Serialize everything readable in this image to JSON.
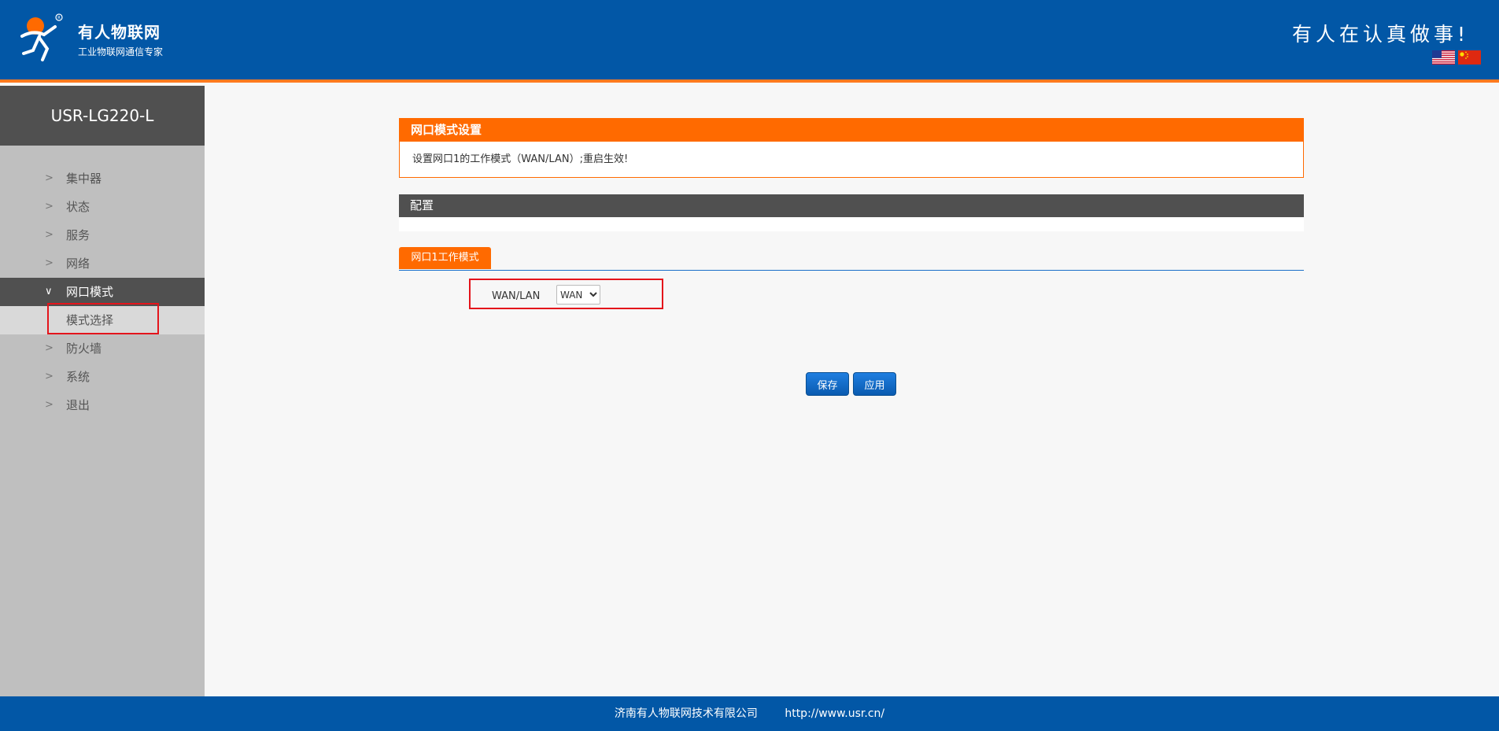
{
  "header": {
    "brand": "有人物联网",
    "brand_sub": "工业物联网通信专家",
    "slogan": "有人在认真做事!",
    "languages": [
      "English",
      "中文"
    ]
  },
  "sidebar": {
    "device": "USR-LG220-L",
    "items": [
      {
        "label": "集中器"
      },
      {
        "label": "状态"
      },
      {
        "label": "服务"
      },
      {
        "label": "网络"
      },
      {
        "label": "网口模式",
        "expanded": true,
        "children": [
          {
            "label": "模式选择",
            "selected": true
          }
        ]
      },
      {
        "label": "防火墙"
      },
      {
        "label": "系统"
      },
      {
        "label": "退出"
      }
    ]
  },
  "main": {
    "notice": {
      "title": "网口模式设置",
      "text": "设置网口1的工作模式（WAN/LAN）;重启生效!"
    },
    "config_title": "配置",
    "tab_label": "网口1工作模式",
    "field": {
      "label": "WAN/LAN",
      "value": "WAN",
      "options": [
        "WAN"
      ]
    },
    "buttons": {
      "save": "保存",
      "apply": "应用"
    }
  },
  "footer": {
    "company": "济南有人物联网技术有限公司",
    "url": "http://www.usr.cn/"
  },
  "colors": {
    "header_blue": "#0257a6",
    "accent_orange": "#ff6a00",
    "highlight_red": "#e4141b",
    "sidebar_dark": "#505050"
  }
}
